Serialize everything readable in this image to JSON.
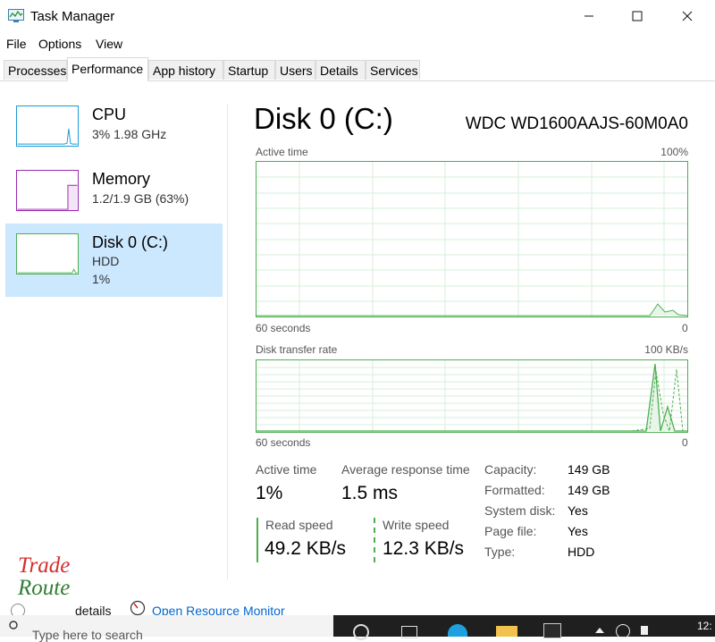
{
  "window": {
    "title": "Task Manager"
  },
  "menu": {
    "file": "File",
    "options": "Options",
    "view": "View"
  },
  "tabs": [
    "Processes",
    "Performance",
    "App history",
    "Startup",
    "Users",
    "Details",
    "Services"
  ],
  "active_tab": "Performance",
  "sidebar": {
    "items": [
      {
        "title": "CPU",
        "sub1": "3%  1.98 GHz",
        "sub2": ""
      },
      {
        "title": "Memory",
        "sub1": "1.2/1.9 GB (63%)",
        "sub2": ""
      },
      {
        "title": "Disk 0 (C:)",
        "sub1": "HDD",
        "sub2": "1%"
      }
    ]
  },
  "main": {
    "title": "Disk 0 (C:)",
    "model": "WDC WD1600AAJS-60M0A0",
    "graph1": {
      "label": "Active time",
      "max": "100%",
      "left_axis": "60 seconds",
      "right_axis": "0"
    },
    "graph2": {
      "label": "Disk transfer rate",
      "max": "100 KB/s",
      "left_axis": "60 seconds",
      "right_axis": "0"
    },
    "stats": {
      "active_time_label": "Active time",
      "active_time": "1%",
      "avg_resp_label": "Average response time",
      "avg_resp": "1.5 ms",
      "read_label": "Read speed",
      "read": "49.2 KB/s",
      "write_label": "Write speed",
      "write": "12.3 KB/s"
    },
    "details": [
      {
        "k": "Capacity:",
        "v": "149 GB"
      },
      {
        "k": "Formatted:",
        "v": "149 GB"
      },
      {
        "k": "System disk:",
        "v": "Yes"
      },
      {
        "k": "Page file:",
        "v": "Yes"
      },
      {
        "k": "Type:",
        "v": "HDD"
      }
    ]
  },
  "footer": {
    "fewer_details": "details",
    "resource_monitor": "Open Resource Monitor"
  },
  "watermark": {
    "line1": "Trade",
    "line2": "Route"
  },
  "taskbar": {
    "search_placeholder": "Type here to search",
    "clock": "12:"
  },
  "colors": {
    "cpu": "#1a9ad6",
    "memory": "#9b27b0",
    "disk": "#4caf50",
    "selected_bg": "#cce8ff",
    "link": "#0066cc"
  }
}
